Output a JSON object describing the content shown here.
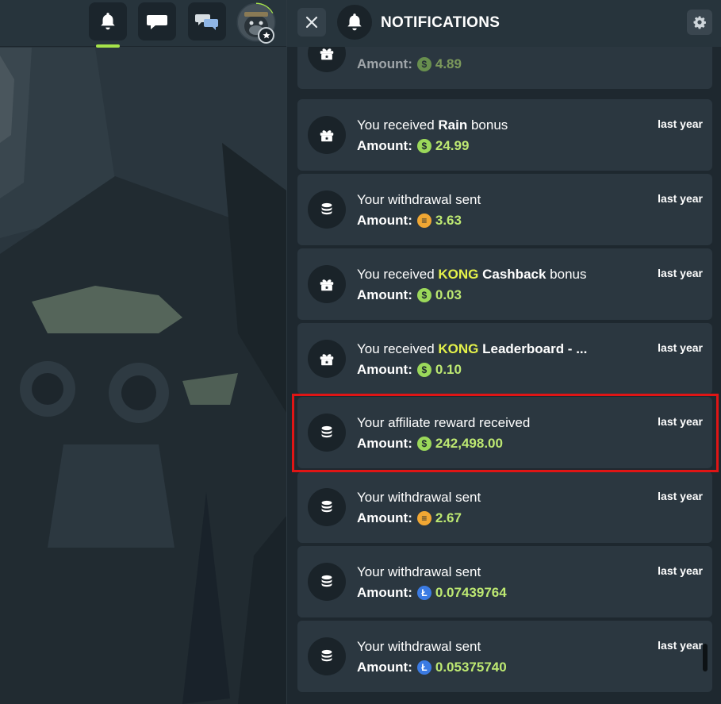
{
  "header": {
    "title": "NOTIFICATIONS"
  },
  "notifications": [
    {
      "title_parts": [],
      "time": "",
      "amount_label": "Amount:",
      "coin": "usd",
      "amount": "4.89"
    },
    {
      "title_parts": [
        {
          "t": "You received ",
          "s": "n"
        },
        {
          "t": "Rain",
          "s": "b"
        },
        {
          "t": " bonus",
          "s": "n"
        }
      ],
      "time": "last year",
      "amount_label": "Amount:",
      "coin": "usd",
      "amount": "24.99",
      "icon": "gift"
    },
    {
      "title_parts": [
        {
          "t": "Your withdrawal sent",
          "s": "n"
        }
      ],
      "time": "last year",
      "amount_label": "Amount:",
      "coin": "gold",
      "amount": "3.63",
      "icon": "coins"
    },
    {
      "title_parts": [
        {
          "t": "You received ",
          "s": "n"
        },
        {
          "t": "KONG",
          "s": "h"
        },
        {
          "t": " Cashback",
          "s": "b"
        },
        {
          "t": " bonus",
          "s": "n"
        }
      ],
      "time": "last year",
      "amount_label": "Amount:",
      "coin": "usd",
      "amount": "0.03",
      "icon": "gift"
    },
    {
      "title_parts": [
        {
          "t": "You received ",
          "s": "n"
        },
        {
          "t": "KONG",
          "s": "h"
        },
        {
          "t": " Leaderboard - ...",
          "s": "b"
        }
      ],
      "time": "last year",
      "amount_label": "Amount:",
      "coin": "usd",
      "amount": "0.10",
      "icon": "gift"
    },
    {
      "title_parts": [
        {
          "t": "Your affiliate reward received",
          "s": "n"
        }
      ],
      "time": "last year",
      "amount_label": "Amount:",
      "coin": "usd",
      "amount": "242,498.00",
      "icon": "coins"
    },
    {
      "title_parts": [
        {
          "t": "Your withdrawal sent",
          "s": "n"
        }
      ],
      "time": "last year",
      "amount_label": "Amount:",
      "coin": "gold",
      "amount": "2.67",
      "icon": "coins"
    },
    {
      "title_parts": [
        {
          "t": "Your withdrawal sent",
          "s": "n"
        }
      ],
      "time": "last year",
      "amount_label": "Amount:",
      "coin": "ltc",
      "amount": "0.07439764",
      "icon": "coins"
    },
    {
      "title_parts": [
        {
          "t": "Your withdrawal sent",
          "s": "n"
        }
      ],
      "time": "last year",
      "amount_label": "Amount:",
      "coin": "ltc",
      "amount": "0.05375740",
      "icon": "coins"
    }
  ],
  "coin_glyphs": {
    "usd": "$",
    "ltc": "Ł",
    "gold": "≡"
  },
  "colors": {
    "accent_green": "#a6e44a",
    "highlight_yellow": "#e5f24a",
    "amount_green": "#bde872",
    "highlight_box": "#e01515"
  }
}
